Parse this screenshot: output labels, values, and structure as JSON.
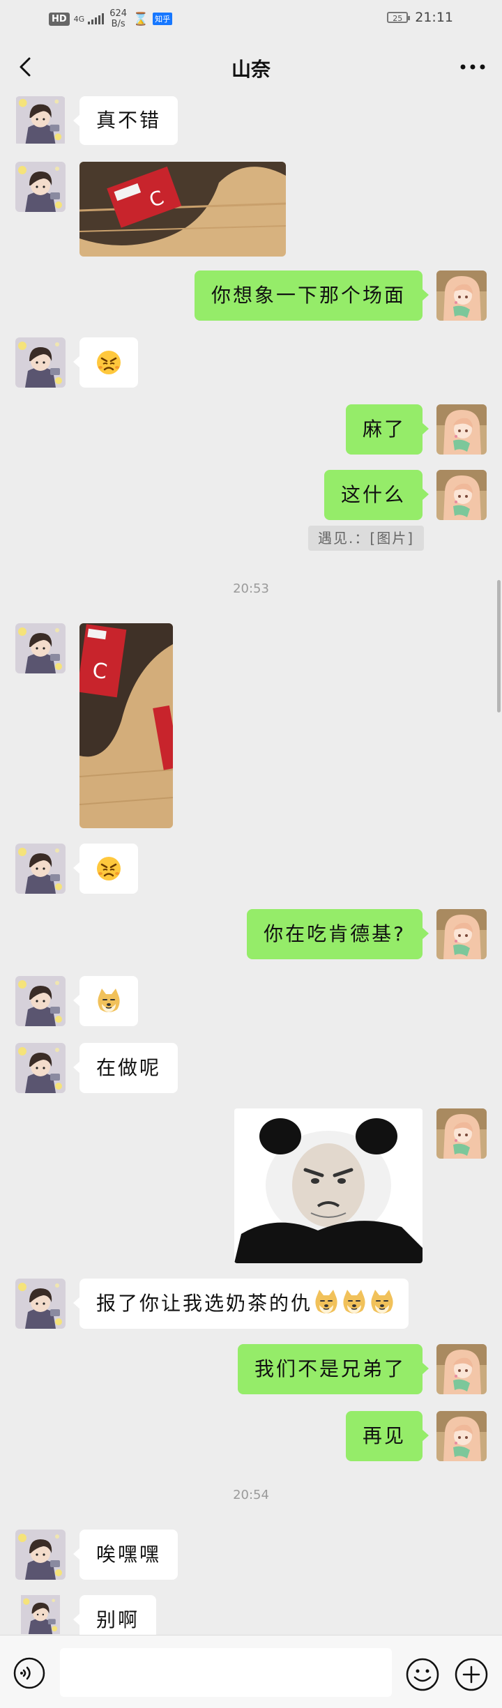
{
  "status_bar": {
    "hd": "HD",
    "network": "4G",
    "speed_value": "624",
    "speed_unit": "B/s",
    "hourglass": "⌛",
    "app_badge": "知乎",
    "battery": "25",
    "time": "21:11"
  },
  "nav": {
    "title": "山奈",
    "back_icon": "chevron-left-icon",
    "more_icon": "more-dots-icon"
  },
  "messages": {
    "m1": "真不错",
    "m3": "你想象一下那个场面",
    "m5": "麻了",
    "m6": "这什么",
    "m6_quote": "遇见.：[图片]",
    "time1": "20:53",
    "m9": "你在吃肯德基?",
    "m11": "在做呢",
    "m13": "报了你让我选奶茶的仇",
    "m14": "我们不是兄弟了",
    "m15": "再见",
    "time2": "20:54",
    "m16": "唉嘿嘿",
    "m17": "别啊"
  },
  "input_bar": {
    "placeholder": "",
    "voice_icon": "voice-icon",
    "emoji_icon": "emoji-icon",
    "plus_icon": "plus-icon"
  },
  "colors": {
    "background": "#ededed",
    "outgoing_bubble": "#95ec69",
    "incoming_bubble": "#ffffff"
  }
}
